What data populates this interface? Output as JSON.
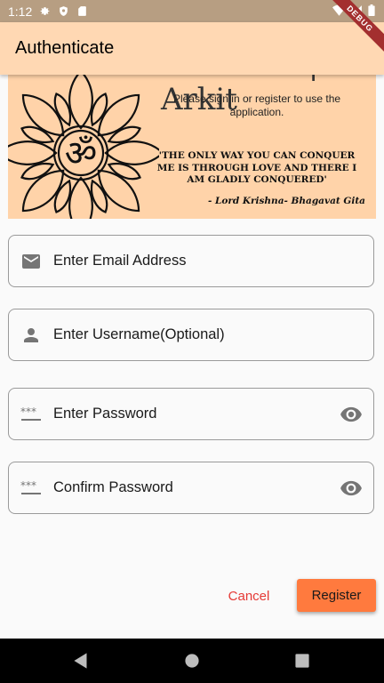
{
  "status_bar": {
    "time": "1:12"
  },
  "app_bar": {
    "title": "Authenticate",
    "debug_label": "DEBUG"
  },
  "banner": {
    "welcome": "Welcome | Arkit",
    "subtitle": "Please sign in or register to use the application.",
    "quote": "'THE ONLY WAY YOU CAN CONQUER ME IS THROUGH LOVE AND THERE I AM GLADLY CONQUERED'",
    "attribution": "- Lord Krishna- Bhagavat Gita"
  },
  "fields": {
    "email": {
      "label": "Enter Email Address",
      "icon": "email-icon"
    },
    "username": {
      "label": "Enter Username(Optional)",
      "icon": "person-icon"
    },
    "password": {
      "label": "Enter Password",
      "icon": "password-icon"
    },
    "confirm_password": {
      "label": "Confirm Password",
      "icon": "password-icon"
    }
  },
  "actions": {
    "cancel": "Cancel",
    "register": "Register"
  },
  "colors": {
    "app_bar": "#ffd8b3",
    "banner": "#ffd3a9",
    "cancel": "#e53935",
    "register": "#ff7a3e"
  }
}
